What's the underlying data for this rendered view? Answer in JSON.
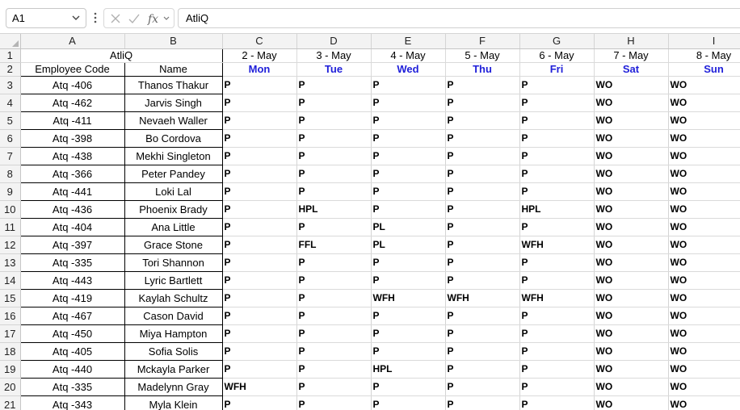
{
  "formula_bar": {
    "name_box": "A1",
    "formula_value": "AtliQ",
    "icons": [
      "chevron-down-icon",
      "more-vertical-icon",
      "cancel-x-icon",
      "enter-check-icon",
      "function-fx-icon"
    ]
  },
  "columns": [
    "A",
    "B",
    "C",
    "D",
    "E",
    "F",
    "G",
    "H",
    "I"
  ],
  "title": "AtliQ",
  "headers": {
    "code": "Employee Code",
    "name": "Name",
    "dates": [
      "2 - May",
      "3 - May",
      "4 - May",
      "5 - May",
      "6 - May",
      "7 - May",
      "8 - May"
    ],
    "days": [
      "Mon",
      "Tue",
      "Wed",
      "Thu",
      "Fri",
      "Sat",
      "Sun"
    ]
  },
  "rows": [
    {
      "num": "3",
      "code": "Atq -406",
      "name": "Thanos Thakur",
      "s": [
        "P",
        "P",
        "P",
        "P",
        "P",
        "WO",
        "WO"
      ]
    },
    {
      "num": "4",
      "code": "Atq -462",
      "name": "Jarvis Singh",
      "s": [
        "P",
        "P",
        "P",
        "P",
        "P",
        "WO",
        "WO"
      ]
    },
    {
      "num": "5",
      "code": "Atq -411",
      "name": "Nevaeh Waller",
      "s": [
        "P",
        "P",
        "P",
        "P",
        "P",
        "WO",
        "WO"
      ]
    },
    {
      "num": "6",
      "code": "Atq -398",
      "name": "Bo Cordova",
      "s": [
        "P",
        "P",
        "P",
        "P",
        "P",
        "WO",
        "WO"
      ]
    },
    {
      "num": "7",
      "code": "Atq -438",
      "name": "Mekhi Singleton",
      "s": [
        "P",
        "P",
        "P",
        "P",
        "P",
        "WO",
        "WO"
      ]
    },
    {
      "num": "8",
      "code": "Atq -366",
      "name": "Peter Pandey",
      "s": [
        "P",
        "P",
        "P",
        "P",
        "P",
        "WO",
        "WO"
      ]
    },
    {
      "num": "9",
      "code": "Atq -441",
      "name": "Loki Lal",
      "s": [
        "P",
        "P",
        "P",
        "P",
        "P",
        "WO",
        "WO"
      ]
    },
    {
      "num": "10",
      "code": "Atq -436",
      "name": "Phoenix Brady",
      "s": [
        "P",
        "HPL",
        "P",
        "P",
        "HPL",
        "WO",
        "WO"
      ]
    },
    {
      "num": "11",
      "code": "Atq -404",
      "name": "Ana Little",
      "s": [
        "P",
        "P",
        "PL",
        "P",
        "P",
        "WO",
        "WO"
      ]
    },
    {
      "num": "12",
      "code": "Atq -397",
      "name": "Grace Stone",
      "s": [
        "P",
        "FFL",
        "PL",
        "P",
        "WFH",
        "WO",
        "WO"
      ]
    },
    {
      "num": "13",
      "code": "Atq -335",
      "name": "Tori Shannon",
      "s": [
        "P",
        "P",
        "P",
        "P",
        "P",
        "WO",
        "WO"
      ]
    },
    {
      "num": "14",
      "code": "Atq -443",
      "name": "Lyric Bartlett",
      "s": [
        "P",
        "P",
        "P",
        "P",
        "P",
        "WO",
        "WO"
      ]
    },
    {
      "num": "15",
      "code": "Atq -419",
      "name": "Kaylah Schultz",
      "s": [
        "P",
        "P",
        "WFH",
        "WFH",
        "WFH",
        "WO",
        "WO"
      ]
    },
    {
      "num": "16",
      "code": "Atq -467",
      "name": "Cason David",
      "s": [
        "P",
        "P",
        "P",
        "P",
        "P",
        "WO",
        "WO"
      ]
    },
    {
      "num": "17",
      "code": "Atq -450",
      "name": "Miya Hampton",
      "s": [
        "P",
        "P",
        "P",
        "P",
        "P",
        "WO",
        "WO"
      ]
    },
    {
      "num": "18",
      "code": "Atq -405",
      "name": "Sofia Solis",
      "s": [
        "P",
        "P",
        "P",
        "P",
        "P",
        "WO",
        "WO"
      ]
    },
    {
      "num": "19",
      "code": "Atq -440",
      "name": "Mckayla Parker",
      "s": [
        "P",
        "P",
        "HPL",
        "P",
        "P",
        "WO",
        "WO"
      ]
    },
    {
      "num": "20",
      "code": "Atq -335",
      "name": "Madelynn Gray",
      "s": [
        "WFH",
        "P",
        "P",
        "P",
        "P",
        "WO",
        "WO"
      ]
    },
    {
      "num": "21",
      "code": "Atq -343",
      "name": "Myla Klein",
      "s": [
        "P",
        "P",
        "P",
        "P",
        "P",
        "WO",
        "WO"
      ]
    }
  ],
  "colors": {
    "day_header": "#1f1fd9",
    "grid_line": "#dadada",
    "header_bg": "#f3f3f3"
  }
}
